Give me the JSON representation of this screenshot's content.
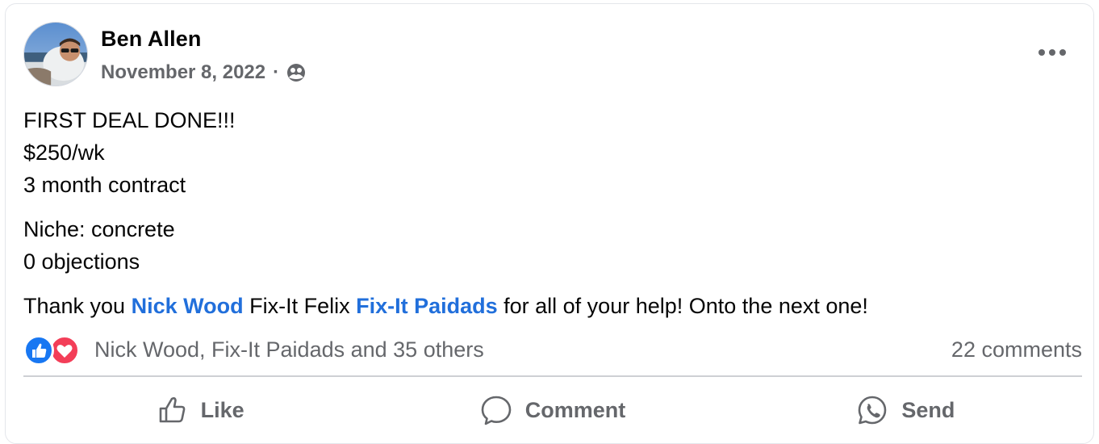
{
  "post": {
    "author": "Ben Allen",
    "date": "November 8, 2022",
    "separator": "·",
    "audience_icon": "friends-icon",
    "more_icon": "more-horizontal-icon",
    "body": {
      "line1": "FIRST DEAL DONE!!!",
      "line2": "$250/wk",
      "line3": "3 month contract",
      "line4": "Niche: concrete",
      "line5": "0 objections",
      "thanks_prefix": "Thank you ",
      "mention1": "Nick Wood",
      "thanks_middle": " Fix-It Felix ",
      "mention2": "Fix-It Paidads",
      "thanks_suffix": " for all of your help! Onto the next one!"
    },
    "reactions": {
      "icons": [
        "like-reaction-icon",
        "love-reaction-icon"
      ],
      "summary": "Nick Wood, Fix-It Paidads and 35 others",
      "comments": "22 comments"
    },
    "actions": {
      "like": "Like",
      "comment": "Comment",
      "send": "Send"
    }
  },
  "colors": {
    "link": "#216fdb",
    "secondary_text": "#65676b",
    "like_blue": "#1877f2",
    "love_red": "#f33e58"
  }
}
